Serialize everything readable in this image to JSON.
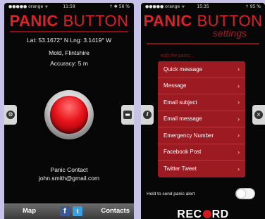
{
  "left_screen": {
    "status": {
      "carrier": "●●●●● orange ᯤ",
      "time": "11:59",
      "battery": "↑ ✱ 56 %"
    },
    "brand": {
      "part1": "PANIC",
      "part2": "BUTTON"
    },
    "location": {
      "coords": "Lat: 53.1672° N Lng: 3.1419° W",
      "place": "Mold, Flintshire",
      "accuracy": "Accuracy: 5 m"
    },
    "contact": {
      "label": "Panic Contact",
      "email": "john.smith@gmail.com"
    },
    "tabbar": {
      "map": "Map",
      "contacts": "Contacts"
    },
    "icons": {
      "settings_tab": "gear-icon",
      "message_tab": "chat-icon",
      "facebook": "facebook-icon",
      "twitter": "twitter-icon"
    }
  },
  "right_screen": {
    "status": {
      "carrier": "●●●●● orange ᯤ",
      "time": "15:35",
      "battery": "↑ 95 %"
    },
    "brand": {
      "part1": "PANIC",
      "part2": "BUTTON",
      "sub": "settings"
    },
    "edit_label": "edit the panic...",
    "menu": [
      {
        "label": "Quick message"
      },
      {
        "label": "Message"
      },
      {
        "label": "Email subject"
      },
      {
        "label": "Email message"
      },
      {
        "label": "Emergency Number"
      },
      {
        "label": "Facebook Post"
      },
      {
        "label": "Twitter Tweet"
      }
    ],
    "hold_label": "Hold to send panic alert",
    "record": {
      "before": "REC",
      "after": "RD"
    },
    "icons": {
      "info_tab": "info-icon",
      "close_tab": "close-icon"
    }
  },
  "colors": {
    "background": "#c7c3e8",
    "brand_red": "#e02028",
    "menu_red": "#9c1a22",
    "screen": "#070707"
  }
}
